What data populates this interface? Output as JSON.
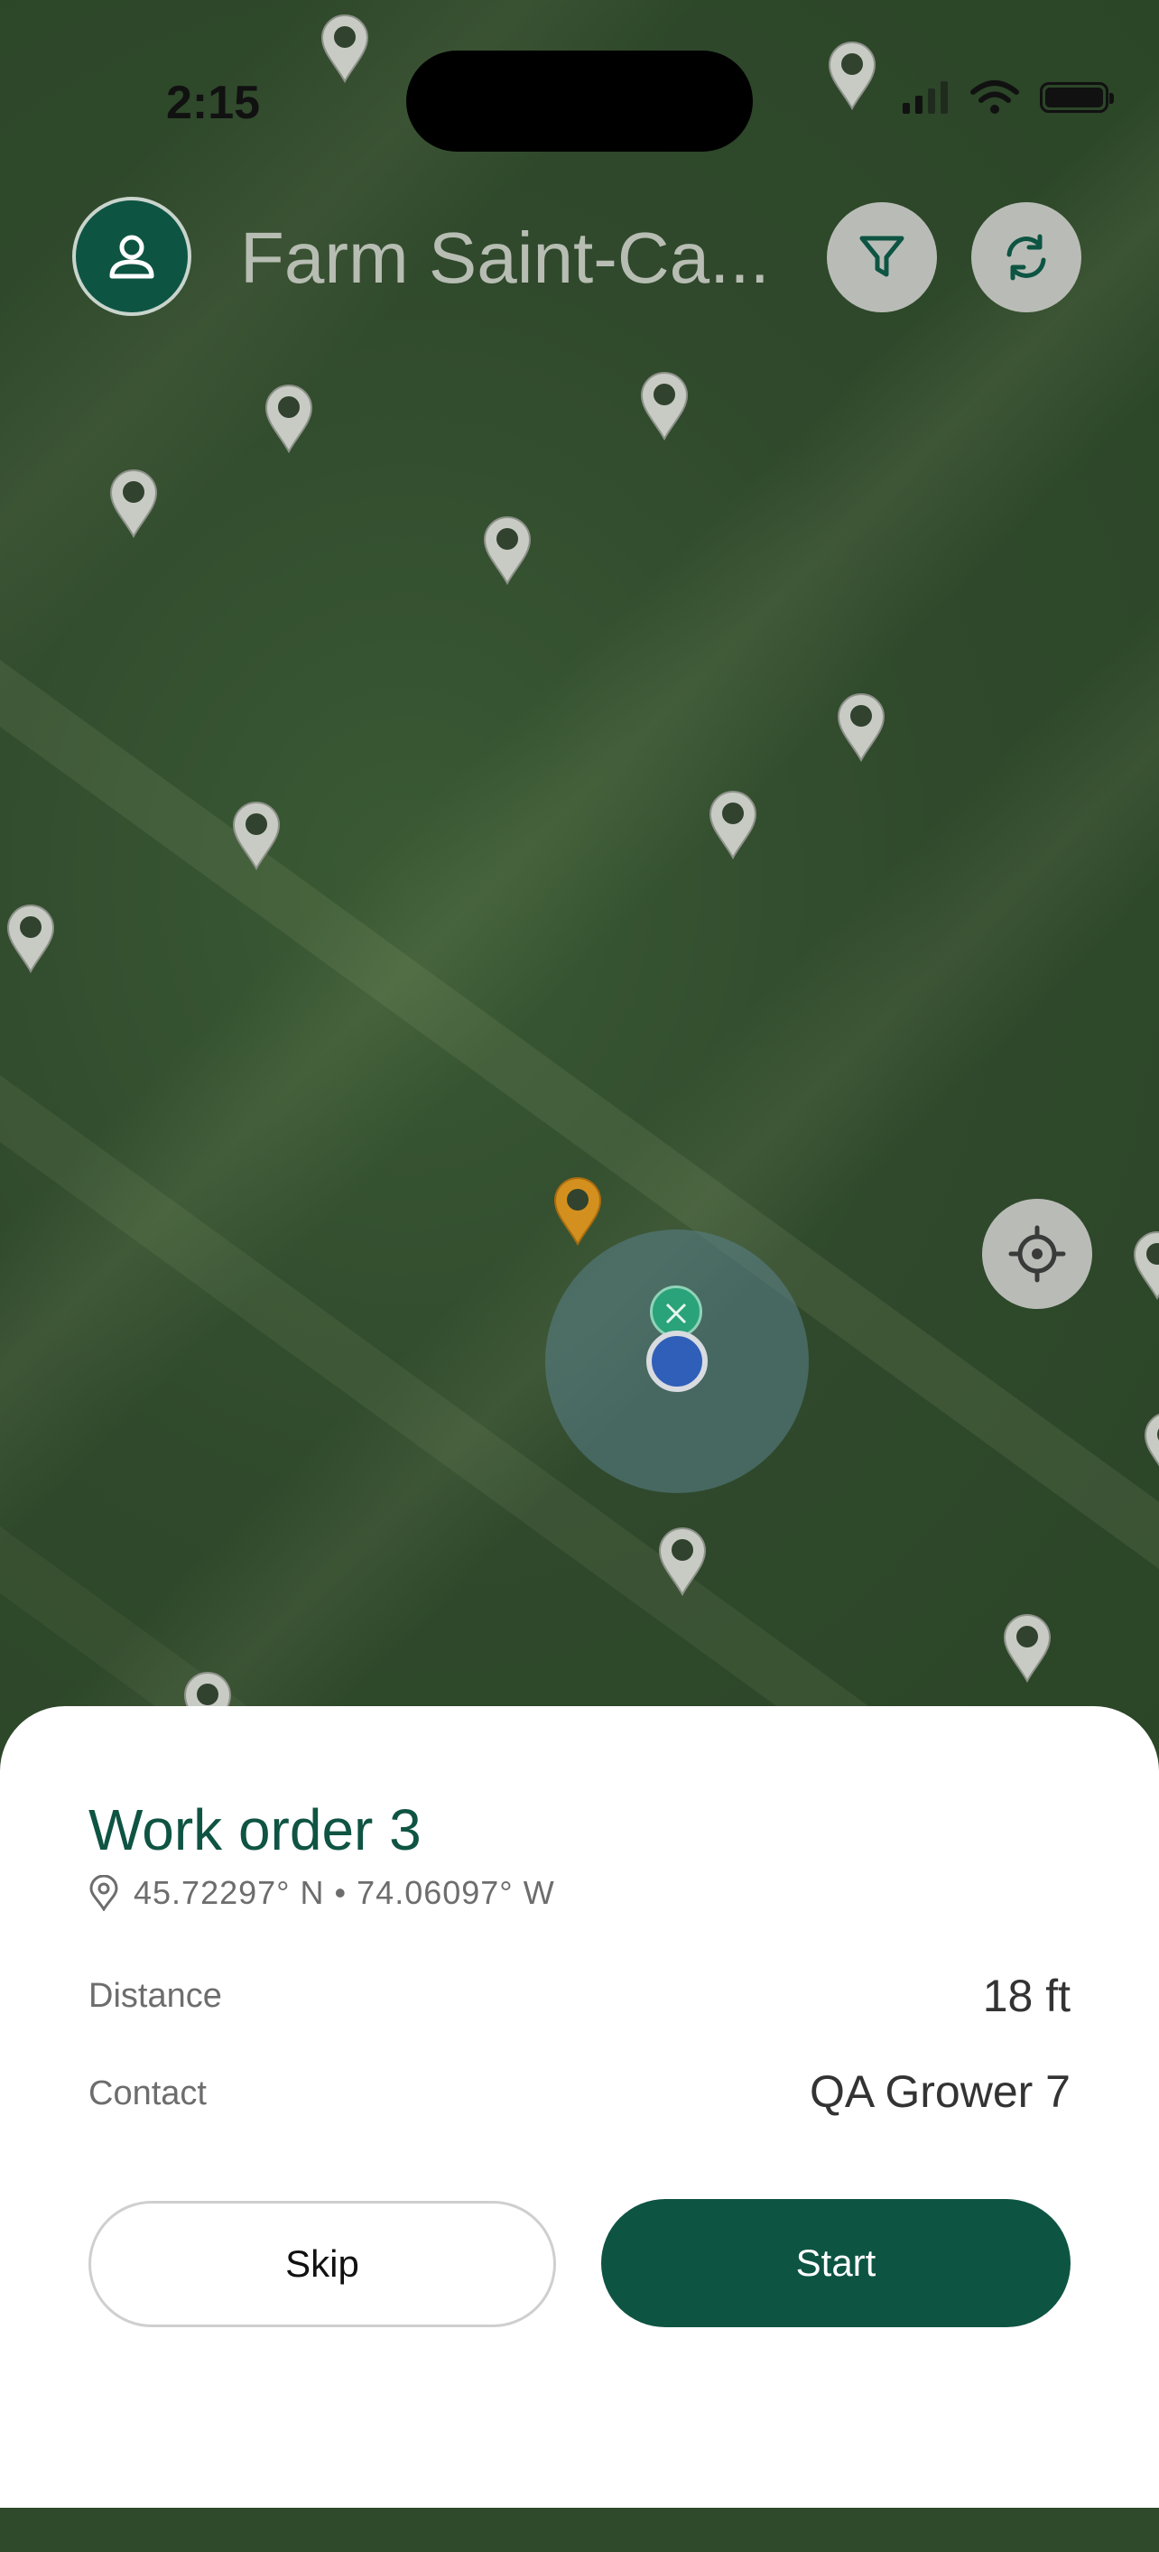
{
  "status_bar": {
    "time": "2:15"
  },
  "header": {
    "farm_title": "Farm Saint-Ca..."
  },
  "icons": {
    "profile": "person-icon",
    "filter": "filter-funnel-icon",
    "sync": "sync-icon",
    "locate": "crosshair-locate-icon",
    "location": "location-pin-icon"
  },
  "colors": {
    "brand_green": "#0e5443",
    "pin_default": "#c8cbc4",
    "pin_selected": "#d4901e",
    "user_location": "#2f5fb8"
  },
  "work_order": {
    "title": "Work order 3",
    "coordinates": "45.72297° N • 74.06097° W",
    "distance_label": "Distance",
    "distance_value": "18 ft",
    "contact_label": "Contact",
    "contact_value": "QA Grower 7",
    "skip_label": "Skip",
    "start_label": "Start"
  }
}
